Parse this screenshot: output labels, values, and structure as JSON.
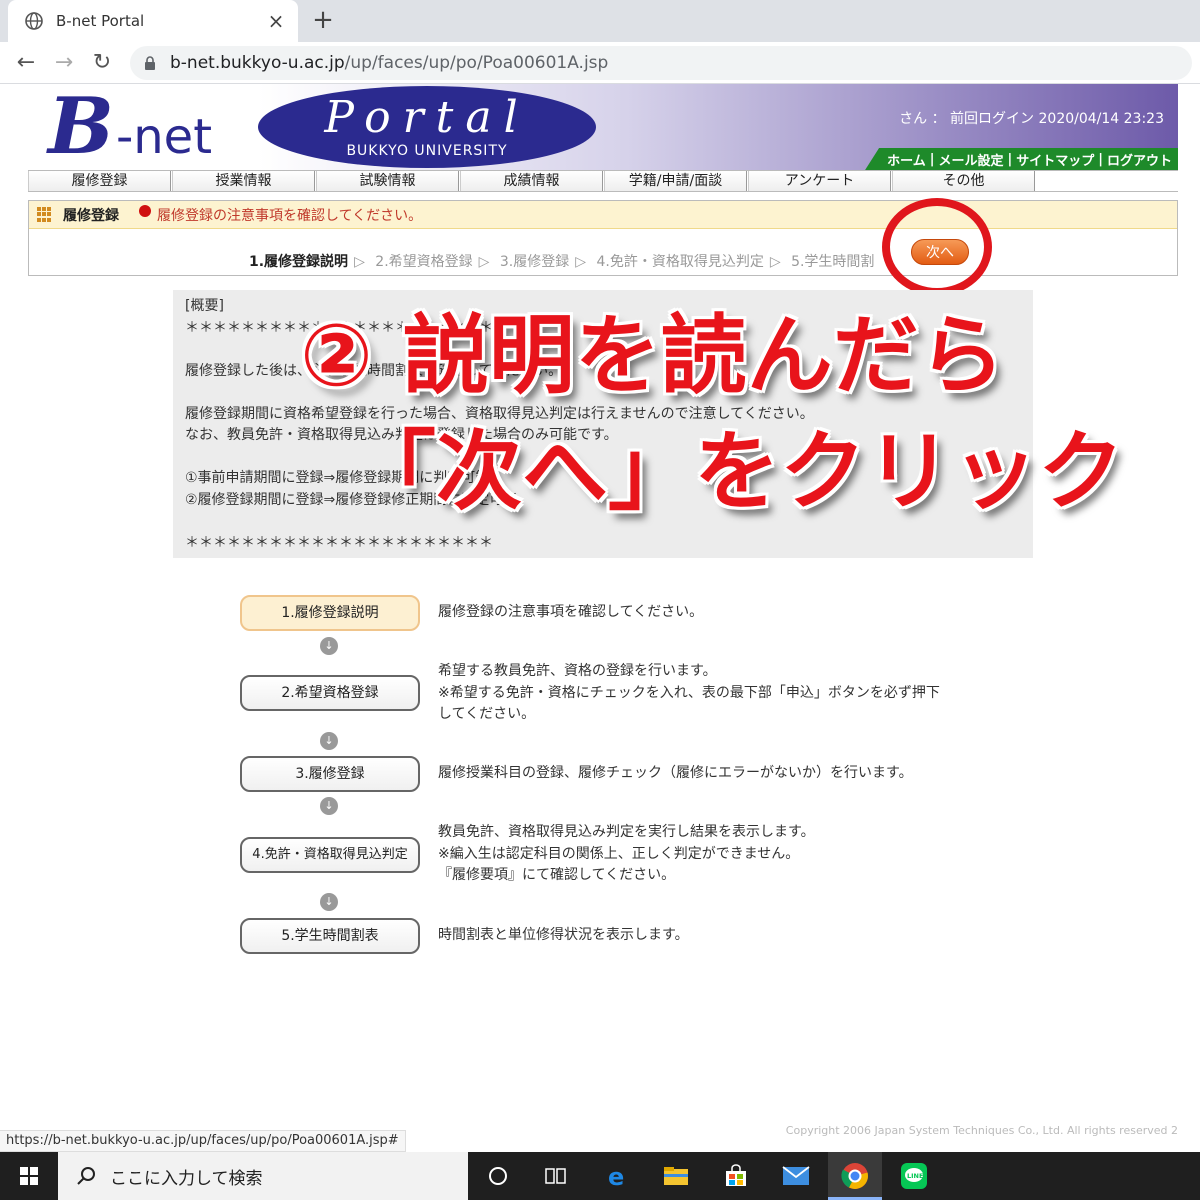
{
  "browser": {
    "tab_title": "B-net Portal",
    "tab_close": "×",
    "new_tab": "+",
    "url_host": "b-net.bukkyo-u.ac.jp",
    "url_path": "/up/faces/up/po/Poa00601A.jsp",
    "back": "←",
    "forward": "→",
    "reload": "↻"
  },
  "header": {
    "logo_b": "B",
    "logo_net": "-net",
    "portal": "Portal",
    "university": "BUKKYO UNIVERSITY",
    "login_info": "さん ： 前回ログイン 2020/04/14 23:23",
    "links": [
      "ホーム",
      "メール設定",
      "サイトマップ",
      "ログアウト"
    ]
  },
  "menu": [
    "履修登録",
    "授業情報",
    "試験情報",
    "成績情報",
    "学籍/申請/面談",
    "アンケート",
    "その他"
  ],
  "panel": {
    "section_title": "履修登録",
    "notice": "履修登録の注意事項を確認してください。",
    "steps": [
      "1.履修登録説明",
      "2.希望資格登録",
      "3.履修登録",
      "4.免許・資格取得見込判定",
      "5.学生時間割"
    ],
    "step_arrow": "▷",
    "next_label": "次へ"
  },
  "overview": {
    "heading": "[概要]",
    "stars_top": "＊＊＊＊＊＊＊＊＊＊＊＊＊＊＊＊＊＊＊＊＊＊",
    "line1": "履修登録した後は、必ず学生時間割表で確認してください。",
    "line2": "履修登録期間に資格希望登録を行った場合、資格取得見込判定は行えませんので注意してください。",
    "line3": "なお、教員免許・資格取得見込み判定は登録した場合のみ可能です。",
    "line4": "①事前申請期間に登録⇒履修登録期間に判定可能",
    "line5": "②履修登録期間に登録⇒履修登録修正期間に判定可能",
    "stars_bottom": "＊＊＊＊＊＊＊＊＊＊＊＊＊＊＊＊＊＊＊＊＊＊"
  },
  "flow": [
    {
      "label": "1.履修登録説明",
      "desc": [
        "履修登録の注意事項を確認してください。"
      ]
    },
    {
      "label": "2.希望資格登録",
      "desc": [
        "希望する教員免許、資格の登録を行います。",
        "※希望する免許・資格にチェックを入れ、表の最下部「申込」ボタンを必ず押下",
        "してください。"
      ]
    },
    {
      "label": "3.履修登録",
      "desc": [
        "履修授業科目の登録、履修チェック（履修にエラーがないか）を行います。"
      ]
    },
    {
      "label": "4.免許・資格取得見込判定",
      "desc": [
        "教員免許、資格取得見込み判定を実行し結果を表示します。",
        "※編入生は認定科目の関係上、正しく判定ができません。",
        "『履修要項』にて確認してください。"
      ]
    },
    {
      "label": "5.学生時間割表",
      "desc": [
        "時間割表と単位修得状況を表示します。"
      ]
    }
  ],
  "flow_arrow": "↓",
  "overlay": {
    "line1": "② 説明を読んだら",
    "line2": "「次へ」をクリック"
  },
  "footer": {
    "copyright": "Copyright 2006 Japan System Techniques Co., Ltd. All rights reserved 2",
    "status_url": "https://b-net.bukkyo-u.ac.jp/up/faces/up/po/Poa00601A.jsp#"
  },
  "taskbar": {
    "search_placeholder": "ここに入力して検索",
    "icons": [
      "cortana-icon",
      "task-view-icon",
      "edge-icon",
      "file-explorer-icon",
      "store-icon",
      "mail-icon",
      "chrome-icon",
      "line-icon"
    ]
  },
  "colors": {
    "brand_navy": "#2b2a8f",
    "nav_green": "#1e8a2a",
    "next_orange": "#e35c13",
    "annotation_red": "#e8141b"
  }
}
